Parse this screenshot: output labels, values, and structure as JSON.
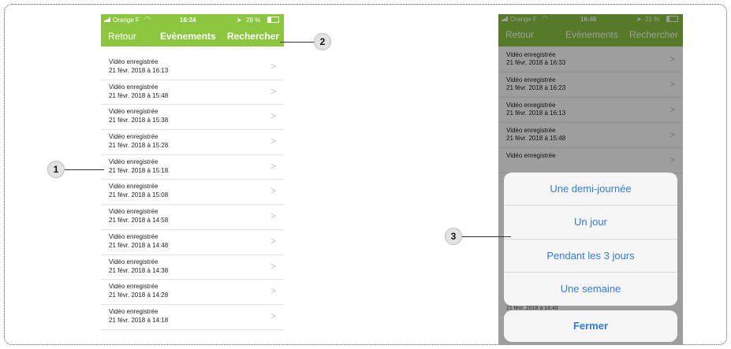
{
  "phone1": {
    "status": {
      "carrier": "Orange F",
      "time": "16:24",
      "battery": "29 %"
    },
    "nav": {
      "back": "Retour",
      "title": "Evènements",
      "search": "Rechercher"
    },
    "rows": [
      {
        "title": "Vidéo enregistrée",
        "date": "21 févr. 2018 à 16:13"
      },
      {
        "title": "Vidéo enregistrée",
        "date": "21 févr. 2018 à 15:48"
      },
      {
        "title": "Vidéo enregistrée",
        "date": "21 févr. 2018 à 15:38"
      },
      {
        "title": "Vidéo enregistrée",
        "date": "21 févr. 2018 à 15:28"
      },
      {
        "title": "Vidéo enregistrée",
        "date": "21 févr. 2018 à 15:18"
      },
      {
        "title": "Vidéo enregistrée",
        "date": "21 févr. 2018 à 15:08"
      },
      {
        "title": "Vidéo enregistrée",
        "date": "21 févr. 2018 à 14:58"
      },
      {
        "title": "Vidéo enregistrée",
        "date": "21 févr. 2018 à 14:48"
      },
      {
        "title": "Vidéo enregistrée",
        "date": "21 févr. 2018 à 14:38"
      },
      {
        "title": "Vidéo enregistrée",
        "date": "21 févr. 2018 à 14:28"
      },
      {
        "title": "Vidéo enregistrée",
        "date": "21 févr. 2018 à 14:18"
      }
    ]
  },
  "phone2": {
    "status": {
      "carrier": "Orange F",
      "time": "16:46",
      "battery": "21 %"
    },
    "nav": {
      "back": "Retour",
      "title": "Evènements",
      "search": "Rechercher"
    },
    "rows": [
      {
        "title": "Vidéo enregistrée",
        "date": "21 févr. 2018 à 16:33"
      },
      {
        "title": "Vidéo enregistrée",
        "date": "21 févr. 2018 à 16:23"
      },
      {
        "title": "Vidéo enregistrée",
        "date": "21 févr. 2018 à 16:13"
      },
      {
        "title": "Vidéo enregistrée",
        "date": "21 févr. 2018 à 15:48"
      },
      {
        "title": "Vidéo enregistrée",
        "date": ""
      }
    ],
    "sheet": {
      "options": [
        "Une demi-journée",
        "Un jour",
        "Pendant les 3 jours",
        "Une semaine"
      ],
      "peek_text": "21 févr. 2018 à 14:48",
      "close": "Fermer"
    }
  },
  "callouts": {
    "c1": "1",
    "c2": "2",
    "c3": "3"
  },
  "icons": {
    "chevron": ">",
    "wifi": "wifi-icon",
    "location": "location-arrow-icon",
    "battery": "battery-icon",
    "signal": "signal-icon"
  },
  "colors": {
    "nav_green": "#8cc63f",
    "action_blue": "#2f7ae5"
  }
}
